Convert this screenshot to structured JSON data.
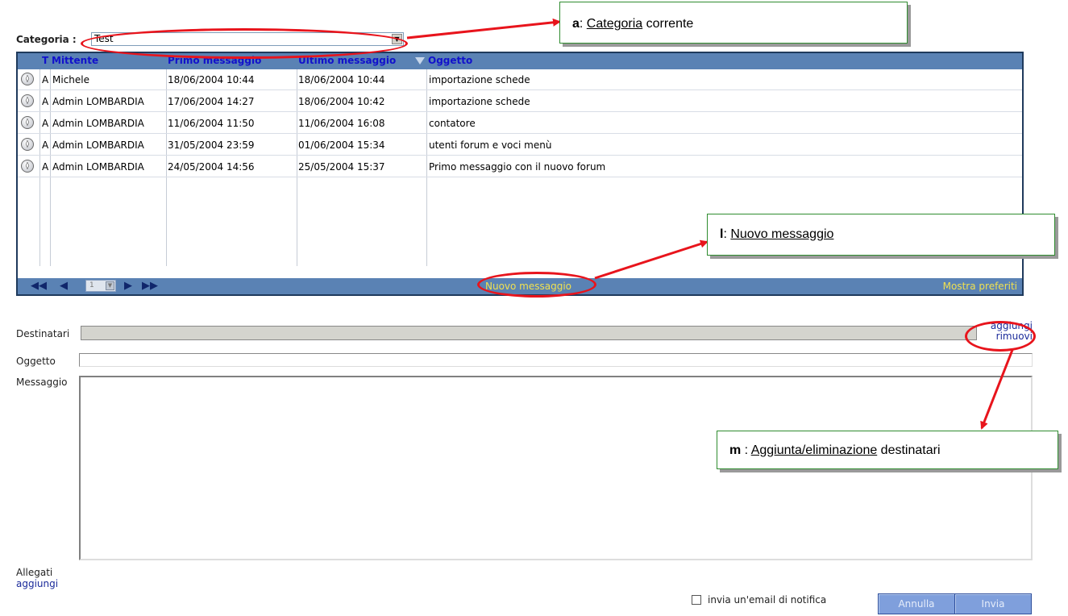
{
  "category": {
    "label": "Categoria :",
    "value": "Test"
  },
  "grid": {
    "headers": {
      "type": "T",
      "sender": "Mittente",
      "first": "Primo messaggio",
      "last": "Ultimo messaggio",
      "subject": "Oggetto"
    },
    "rows": [
      {
        "type": "A",
        "sender": "Michele",
        "first": "18/06/2004 10:44",
        "last": "18/06/2004 10:44",
        "subject": "importazione schede"
      },
      {
        "type": "A",
        "sender": "Admin LOMBARDIA",
        "first": "17/06/2004 14:27",
        "last": "18/06/2004 10:42",
        "subject": "importazione schede"
      },
      {
        "type": "A",
        "sender": "Admin LOMBARDIA",
        "first": "11/06/2004 11:50",
        "last": "11/06/2004 16:08",
        "subject": "contatore"
      },
      {
        "type": "A",
        "sender": "Admin LOMBARDIA",
        "first": "31/05/2004 23:59",
        "last": "01/06/2004 15:34",
        "subject": "utenti forum e voci menù"
      },
      {
        "type": "A",
        "sender": "Admin LOMBARDIA",
        "first": "24/05/2004 14:56",
        "last": "25/05/2004 15:37",
        "subject": "Primo messaggio con il nuovo forum"
      }
    ],
    "footer": {
      "first_icon": "first-page-icon",
      "prev_icon": "prev-page-icon",
      "page": "1",
      "next_icon": "next-page-icon",
      "last_icon": "last-page-icon",
      "new_message": "Nuovo messaggio",
      "show_favorites": "Mostra preferiti"
    }
  },
  "form": {
    "recipients_label": "Destinatari",
    "add": "aggiungi",
    "remove": "rimuovi",
    "subject_label": "Oggetto",
    "message_label": "Messaggio",
    "attachments_label": "Allegati",
    "attachments_add": "aggiungi",
    "notify_label": "invia un'email di notifica",
    "cancel": "Annulla",
    "send": "Invia"
  },
  "callouts": {
    "a": {
      "key": "a",
      "sep": ": ",
      "underlined": "Categoria",
      "rest": " corrente"
    },
    "l": {
      "key": "l",
      "sep": ": ",
      "underlined": "Nuovo messaggio",
      "rest": ""
    },
    "m": {
      "key": "m",
      "sep": " : ",
      "underlined": "Aggiunta/eliminazione",
      "rest": " destinatari"
    }
  },
  "colors": {
    "header_blue": "#5a82b4",
    "highlight_red": "#e8141c",
    "callout_border": "#2f8c2f",
    "footer_text": "#f0e050"
  }
}
